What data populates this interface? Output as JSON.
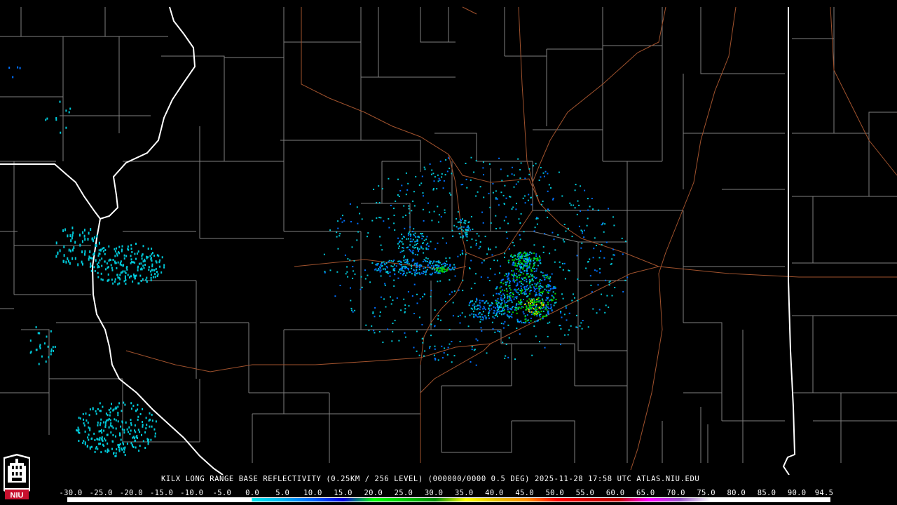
{
  "product_caption": "KILX LONG RANGE BASE REFLECTIVITY (0.25KM / 256 LEVEL) (000000/0000 0.5 DEG) 2025-11-28 17:58 UTC  ATLAS.NIU.EDU",
  "logo_text": "NIU",
  "colorbar": {
    "tick_labels": [
      "-30.0",
      "-25.0",
      "-20.0",
      "-15.0",
      "-10.0",
      "-5.0",
      "0.0",
      "5.0",
      "10.0",
      "15.0",
      "20.0",
      "25.0",
      "30.0",
      "35.0",
      "40.0",
      "45.0",
      "50.0",
      "55.0",
      "60.0",
      "65.0",
      "70.0",
      "75.0",
      "80.0",
      "85.0",
      "90.0",
      "94.5"
    ],
    "tick_values": [
      -30,
      -25,
      -20,
      -15,
      -10,
      -5,
      0,
      5,
      10,
      15,
      20,
      25,
      30,
      35,
      40,
      45,
      50,
      55,
      60,
      65,
      70,
      75,
      80,
      85,
      90,
      94.5
    ],
    "stops": [
      {
        "value": -30,
        "color": "#ffffff"
      },
      {
        "value": 0,
        "color": "#ffffff"
      },
      {
        "value": 0.1,
        "color": "#00e5ee"
      },
      {
        "value": 5,
        "color": "#00b4f0"
      },
      {
        "value": 10,
        "color": "#0064ff"
      },
      {
        "value": 15,
        "color": "#0000e0"
      },
      {
        "value": 20,
        "color": "#00ff00"
      },
      {
        "value": 25,
        "color": "#00c800"
      },
      {
        "value": 30,
        "color": "#008c00"
      },
      {
        "value": 35,
        "color": "#ffff00"
      },
      {
        "value": 40,
        "color": "#e6c000"
      },
      {
        "value": 45,
        "color": "#ff9000"
      },
      {
        "value": 50,
        "color": "#ff0000"
      },
      {
        "value": 55,
        "color": "#d60000"
      },
      {
        "value": 60,
        "color": "#c00000"
      },
      {
        "value": 65,
        "color": "#ff00ff"
      },
      {
        "value": 70,
        "color": "#9955c9"
      },
      {
        "value": 75,
        "color": "#ffffff"
      },
      {
        "value": 94.5,
        "color": "#ffffff"
      }
    ]
  },
  "colors": {
    "background": "#000000",
    "county_lines": "#808080",
    "state_lines": "#ffffff",
    "highways": "#a0522d",
    "echo_light": "#00c8d8",
    "echo_moderate": "#0070ff",
    "echo_strong": "#00d000",
    "echo_peak": "#ffd000",
    "logo_red": "#c8102e"
  }
}
